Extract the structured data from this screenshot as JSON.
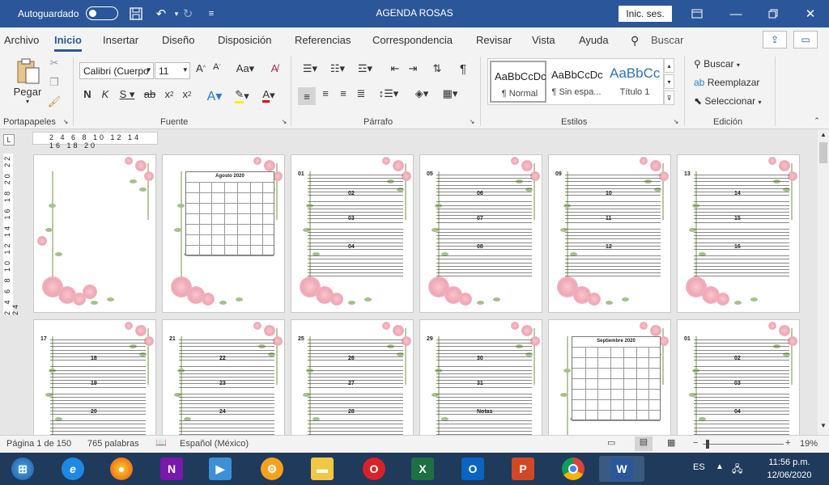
{
  "titlebar": {
    "autosave_label": "Autoguardado",
    "doc_title": "AGENDA ROSAS",
    "signin_label": "Inic. ses."
  },
  "menu": {
    "items": [
      "Archivo",
      "Inicio",
      "Insertar",
      "Diseño",
      "Disposición",
      "Referencias",
      "Correspondencia",
      "Revisar",
      "Vista",
      "Ayuda"
    ],
    "search_label": "Buscar"
  },
  "ribbon": {
    "clipboard": {
      "paste_label": "Pegar",
      "group_label": "Portapapeles"
    },
    "font": {
      "family": "Calibri (Cuerpo",
      "size": "11",
      "group_label": "Fuente"
    },
    "paragraph": {
      "group_label": "Párrafo"
    },
    "styles": {
      "group_label": "Estilos",
      "items": [
        {
          "sample": "AaBbCcDc",
          "label": "¶ Normal"
        },
        {
          "sample": "AaBbCcDc",
          "label": "¶ Sin espa..."
        },
        {
          "sample": "AaBbCc",
          "label": "Título 1"
        }
      ]
    },
    "editing": {
      "group_label": "Edición",
      "find_label": "Buscar",
      "replace_label": "Reemplazar",
      "select_label": "Seleccionar"
    }
  },
  "ruler": {
    "h_numbers": "2 4 6 8 10 12 14 16 18 20",
    "v_numbers": "2 4 6 8 10 12 14 16 18 20 22 24"
  },
  "pages": {
    "calendar1_title": "Agosto 2020",
    "calendar2_title": "Septiembre 2020",
    "row1_days": [
      [],
      [],
      [
        "01",
        "02",
        "03",
        "04"
      ],
      [
        "05",
        "06",
        "07",
        "08"
      ],
      [
        "09",
        "10",
        "11",
        "12"
      ],
      [
        "13",
        "14",
        "15",
        "16"
      ]
    ],
    "row2_days": [
      [
        "17",
        "18",
        "19",
        "20"
      ],
      [
        "21",
        "22",
        "23",
        "24"
      ],
      [
        "25",
        "26",
        "27",
        "28"
      ],
      [
        "29",
        "30",
        "31",
        "Notas"
      ],
      [],
      [
        "01",
        "02",
        "03",
        "04"
      ]
    ]
  },
  "status": {
    "page": "Página 1 de 150",
    "words": "765 palabras",
    "language": "Español (México)",
    "zoom": "19%"
  },
  "taskbar": {
    "lang": "ES",
    "time": "11:56 p.m.",
    "date": "12/06/2020"
  },
  "colors": {
    "word_blue": "#2b579a",
    "taskbar": "#1f3a5a",
    "rose": "#f0a6b5",
    "leaf": "#a7c08c"
  }
}
